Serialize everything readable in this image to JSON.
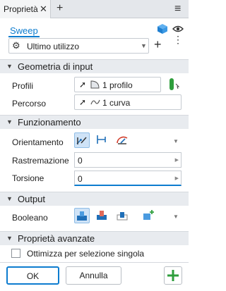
{
  "tab": {
    "title": "Proprietà",
    "close": "✕",
    "add": "+"
  },
  "menu_icon": "≡",
  "command": {
    "name": "Sweep"
  },
  "preset": {
    "value": "Ultimo utilizzo",
    "add": "+",
    "more": "⋮"
  },
  "sections": {
    "input": "Geometria di input",
    "behavior": "Funzionamento",
    "output": "Output",
    "advanced": "Proprietà avanzate"
  },
  "input": {
    "profiles_label": "Profili",
    "profiles_value": "1 profilo",
    "path_label": "Percorso",
    "path_value": "1 curva"
  },
  "behavior": {
    "orientation_label": "Orientamento",
    "taper_label": "Rastremazione",
    "taper_value": "0",
    "twist_label": "Torsione",
    "twist_value": "0"
  },
  "output": {
    "boolean_label": "Booleano"
  },
  "advanced": {
    "optimize_label": "Ottimizza per selezione singola"
  },
  "footer": {
    "ok": "OK",
    "cancel": "Annulla"
  },
  "colors": {
    "accent": "#0d7ccf",
    "section_bg": "#e8ebef",
    "active_btn": "#cfe3f7",
    "green": "#2e9e3c"
  }
}
